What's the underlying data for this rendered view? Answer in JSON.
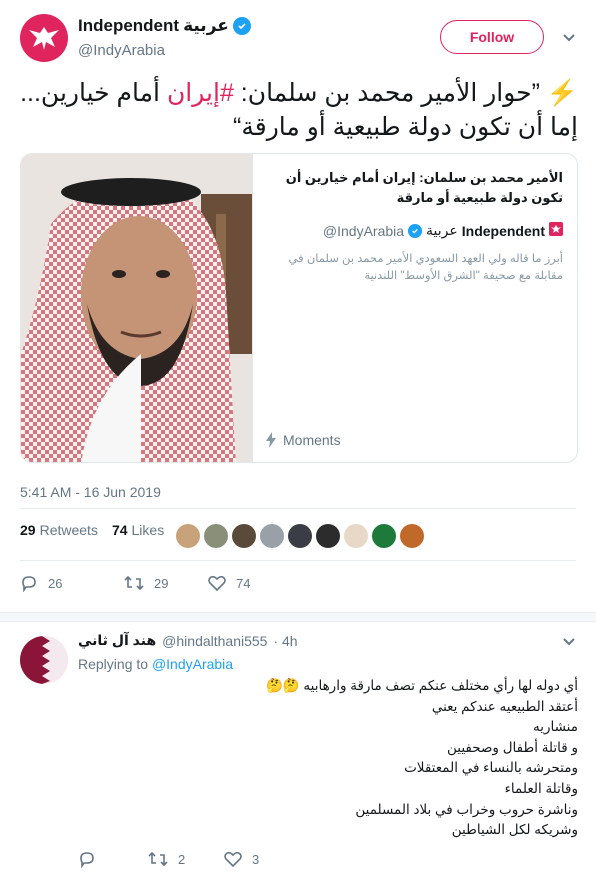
{
  "account": {
    "name": "Independent",
    "name_arabic": "عربية",
    "handle": "@IndyArabia",
    "follow_label": "Follow"
  },
  "tweet": {
    "text_part1": "⚡️ ”حوار الأمير محمد بن سلمان: ",
    "hashtag": "#إيران",
    "text_part2": " أمام خيارين... إما أن تكون دولة طبيعية أو مارقة“",
    "timestamp": "5:41 AM - 16 Jun 2019",
    "retweets_count": "29",
    "retweets_label": "Retweets",
    "likes_count": "74",
    "likes_label": "Likes",
    "reply_count": "26",
    "retweet_count": "29",
    "like_count": "74"
  },
  "card": {
    "title": "الأمير محمد بن سلمان: إيران أمام خيارين أن تكون دولة طبيعية أو مارقة",
    "byline_name": "Independent",
    "byline_arabic": "عربية",
    "byline_handle": "IndyArabia@",
    "description": "أبرز ما قاله ولي العهد السعودي الأمير محمد بن سلمان في مقابلة مع صحيفة \"الشرق الأوسط\" اللندنية",
    "moments_label": "Moments"
  },
  "likers": {
    "colors": [
      "#c8a27a",
      "#8a8f7a",
      "#5a4a3a",
      "#9aa0a8",
      "#3a3d45",
      "#2c2c2c",
      "#e8d8c8",
      "#1e7a3a",
      "#c0692a"
    ]
  },
  "reply": {
    "name": "هند آل ثاني",
    "handle": "@hindalthani555",
    "time": "· 4h",
    "replying_prefix": "Replying to",
    "replying_to": "@IndyArabia",
    "lines": [
      "أي دوله لها رأي مختلف عنكم تصف مارقة وارهابيه 🤔🤔",
      "أعتقد الطبيعيه عندكم يعني",
      "منشاريه",
      "و قاتلة أطفال وصحفيين",
      "ومتحرشه بالنساء في المعتقلات",
      "وقاتلة العلماء",
      "وناشرة حروب وخراب في بلاد  المسلمين",
      "وشريكه لكل الشياطين"
    ],
    "reply_count": "",
    "retweet_count": "2",
    "like_count": "3"
  },
  "colors": {
    "accent": "#e0245e",
    "link": "#1da1f2",
    "muted": "#657786"
  }
}
